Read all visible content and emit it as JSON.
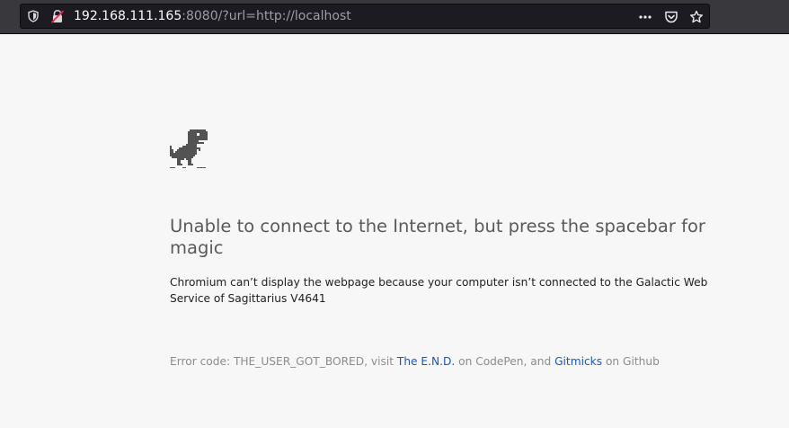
{
  "browser": {
    "url_host": "192.168.111.165",
    "url_rest": ":8080/?url=http://localhost",
    "icons": {
      "shield": "shield-icon",
      "insecure_lock": "insecure-lock-icon",
      "page_actions": "more-dots-icon",
      "pocket": "pocket-icon",
      "bookmark": "star-icon"
    },
    "colors": {
      "toolbar": "#38383d",
      "urlbar": "#1c1b22",
      "insecure_red": "#e22850"
    }
  },
  "page": {
    "headline": "Unable to connect to the Internet, but press the spacebar for magic",
    "description": "Chromium can’t display the webpage because your computer isn’t connected to the Galactic Web Service of Sagittarius V4641",
    "footer": {
      "prefix": "Error code: THE_USER_GOT_BORED, visit ",
      "link1": "The E.N.D.",
      "middle": " on CodePen, and ",
      "link2": "Gitmicks",
      "suffix": " on Github"
    },
    "colors": {
      "background": "#f7f7f7",
      "link": "#1a56c4",
      "dino": "#535353"
    }
  }
}
